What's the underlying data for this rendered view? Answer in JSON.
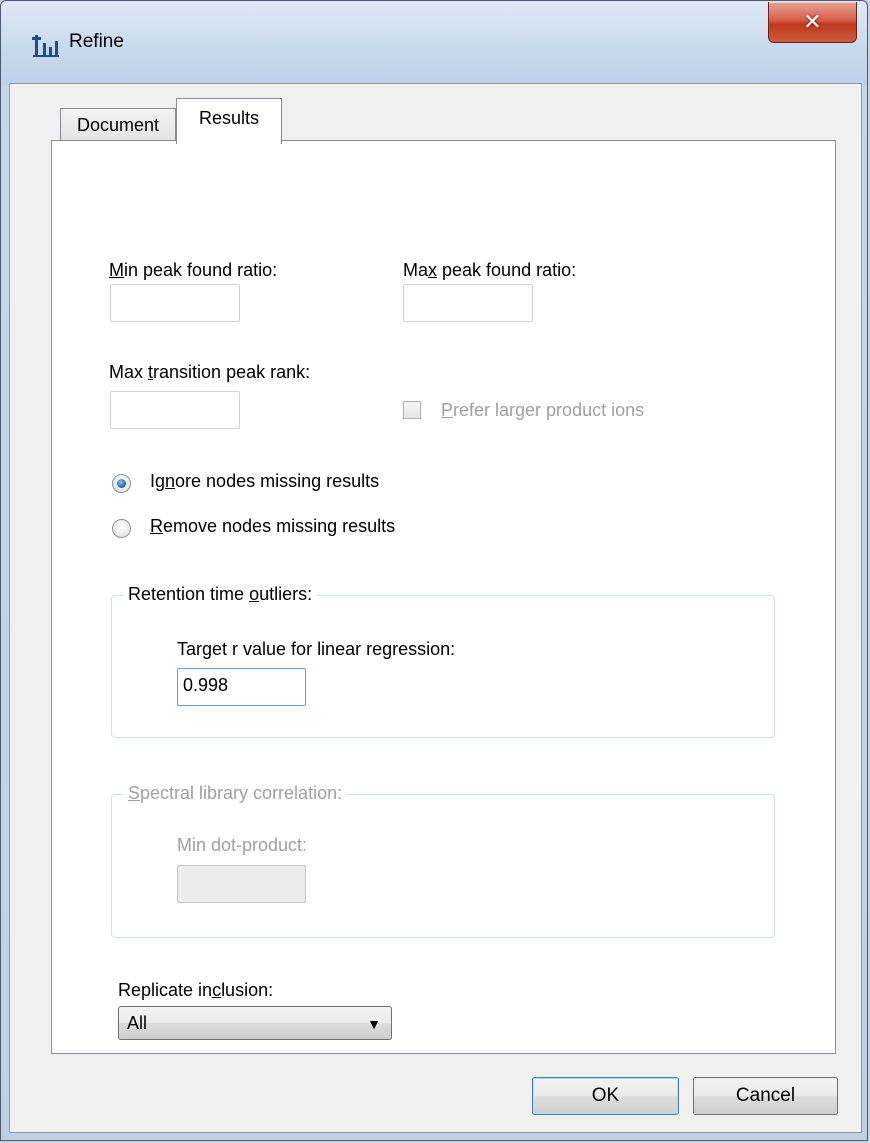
{
  "window": {
    "title": "Refine"
  },
  "tabs": [
    {
      "label": "Document"
    },
    {
      "label": "Results"
    }
  ],
  "results": {
    "min_peak_label_prefix": "",
    "min_peak_label_mnemonic": "M",
    "min_peak_label_rest": "in peak found ratio:",
    "min_peak_value": "",
    "max_peak_label_prefix": "Ma",
    "max_peak_label_mnemonic": "x",
    "max_peak_label_rest": " peak found ratio:",
    "max_peak_value": "",
    "max_transition_label_prefix": "Max ",
    "max_transition_label_mnemonic": "t",
    "max_transition_label_rest": "ransition peak rank:",
    "max_transition_value": "",
    "prefer_label_prefix": "",
    "prefer_label_mnemonic": "P",
    "prefer_label_rest": "refer larger product ions",
    "prefer_checked": false,
    "ignore_label_prefix": "Ig",
    "ignore_label_mnemonic": "n",
    "ignore_label_rest": "ore nodes missing results",
    "remove_label_prefix": "",
    "remove_label_mnemonic": "R",
    "remove_label_rest": "emove nodes missing results",
    "selected_option": "ignore"
  },
  "rt_outliers": {
    "title_prefix": "Retention time ",
    "title_mnemonic": "o",
    "title_rest": "utliers:",
    "target_label": "Target r value for linear regression:",
    "target_value": "0.998"
  },
  "spectral": {
    "title_prefix": "",
    "title_mnemonic": "S",
    "title_rest": "pectral library correlation:",
    "min_dot_label": "Min dot-product:",
    "min_dot_value": ""
  },
  "replicate": {
    "label_prefix": "Replicate in",
    "label_mnemonic": "c",
    "label_rest": "lusion:",
    "selected": "All"
  },
  "buttons": {
    "ok": "OK",
    "cancel": "Cancel"
  },
  "colors": {
    "accent": "#1c5ea0",
    "close_button": "#c0391f"
  },
  "icons": {
    "app": "refine-app-icon",
    "close": "close-icon",
    "dropdown": "chevron-down-icon"
  }
}
